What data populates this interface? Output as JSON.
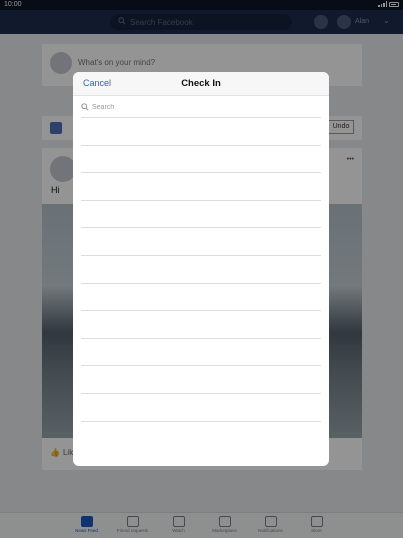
{
  "status_bar": {
    "time": "10:00"
  },
  "header": {
    "search_placeholder": "Search Facebook",
    "user_name": "Alan"
  },
  "feed": {
    "composer_placeholder": "What's on your mind?",
    "undo_label": "Undo",
    "post_text": "Hi",
    "like_label": "Like",
    "more_label": "•••"
  },
  "modal": {
    "cancel_label": "Cancel",
    "title": "Check In",
    "search_placeholder": "Search",
    "row_count": 12
  },
  "bottom_nav": {
    "items": [
      {
        "label": "News Feed",
        "icon": "news-feed-icon",
        "active": true
      },
      {
        "label": "Friend requests",
        "icon": "friends-icon"
      },
      {
        "label": "Watch",
        "icon": "watch-icon"
      },
      {
        "label": "Marketplace",
        "icon": "marketplace-icon"
      },
      {
        "label": "Notifications",
        "icon": "bell-icon"
      },
      {
        "label": "More",
        "icon": "menu-icon"
      }
    ]
  },
  "colors": {
    "header": "#1e2e4f",
    "accent": "#2d63c8",
    "overlay": "rgba(0,0,0,0.42)"
  }
}
